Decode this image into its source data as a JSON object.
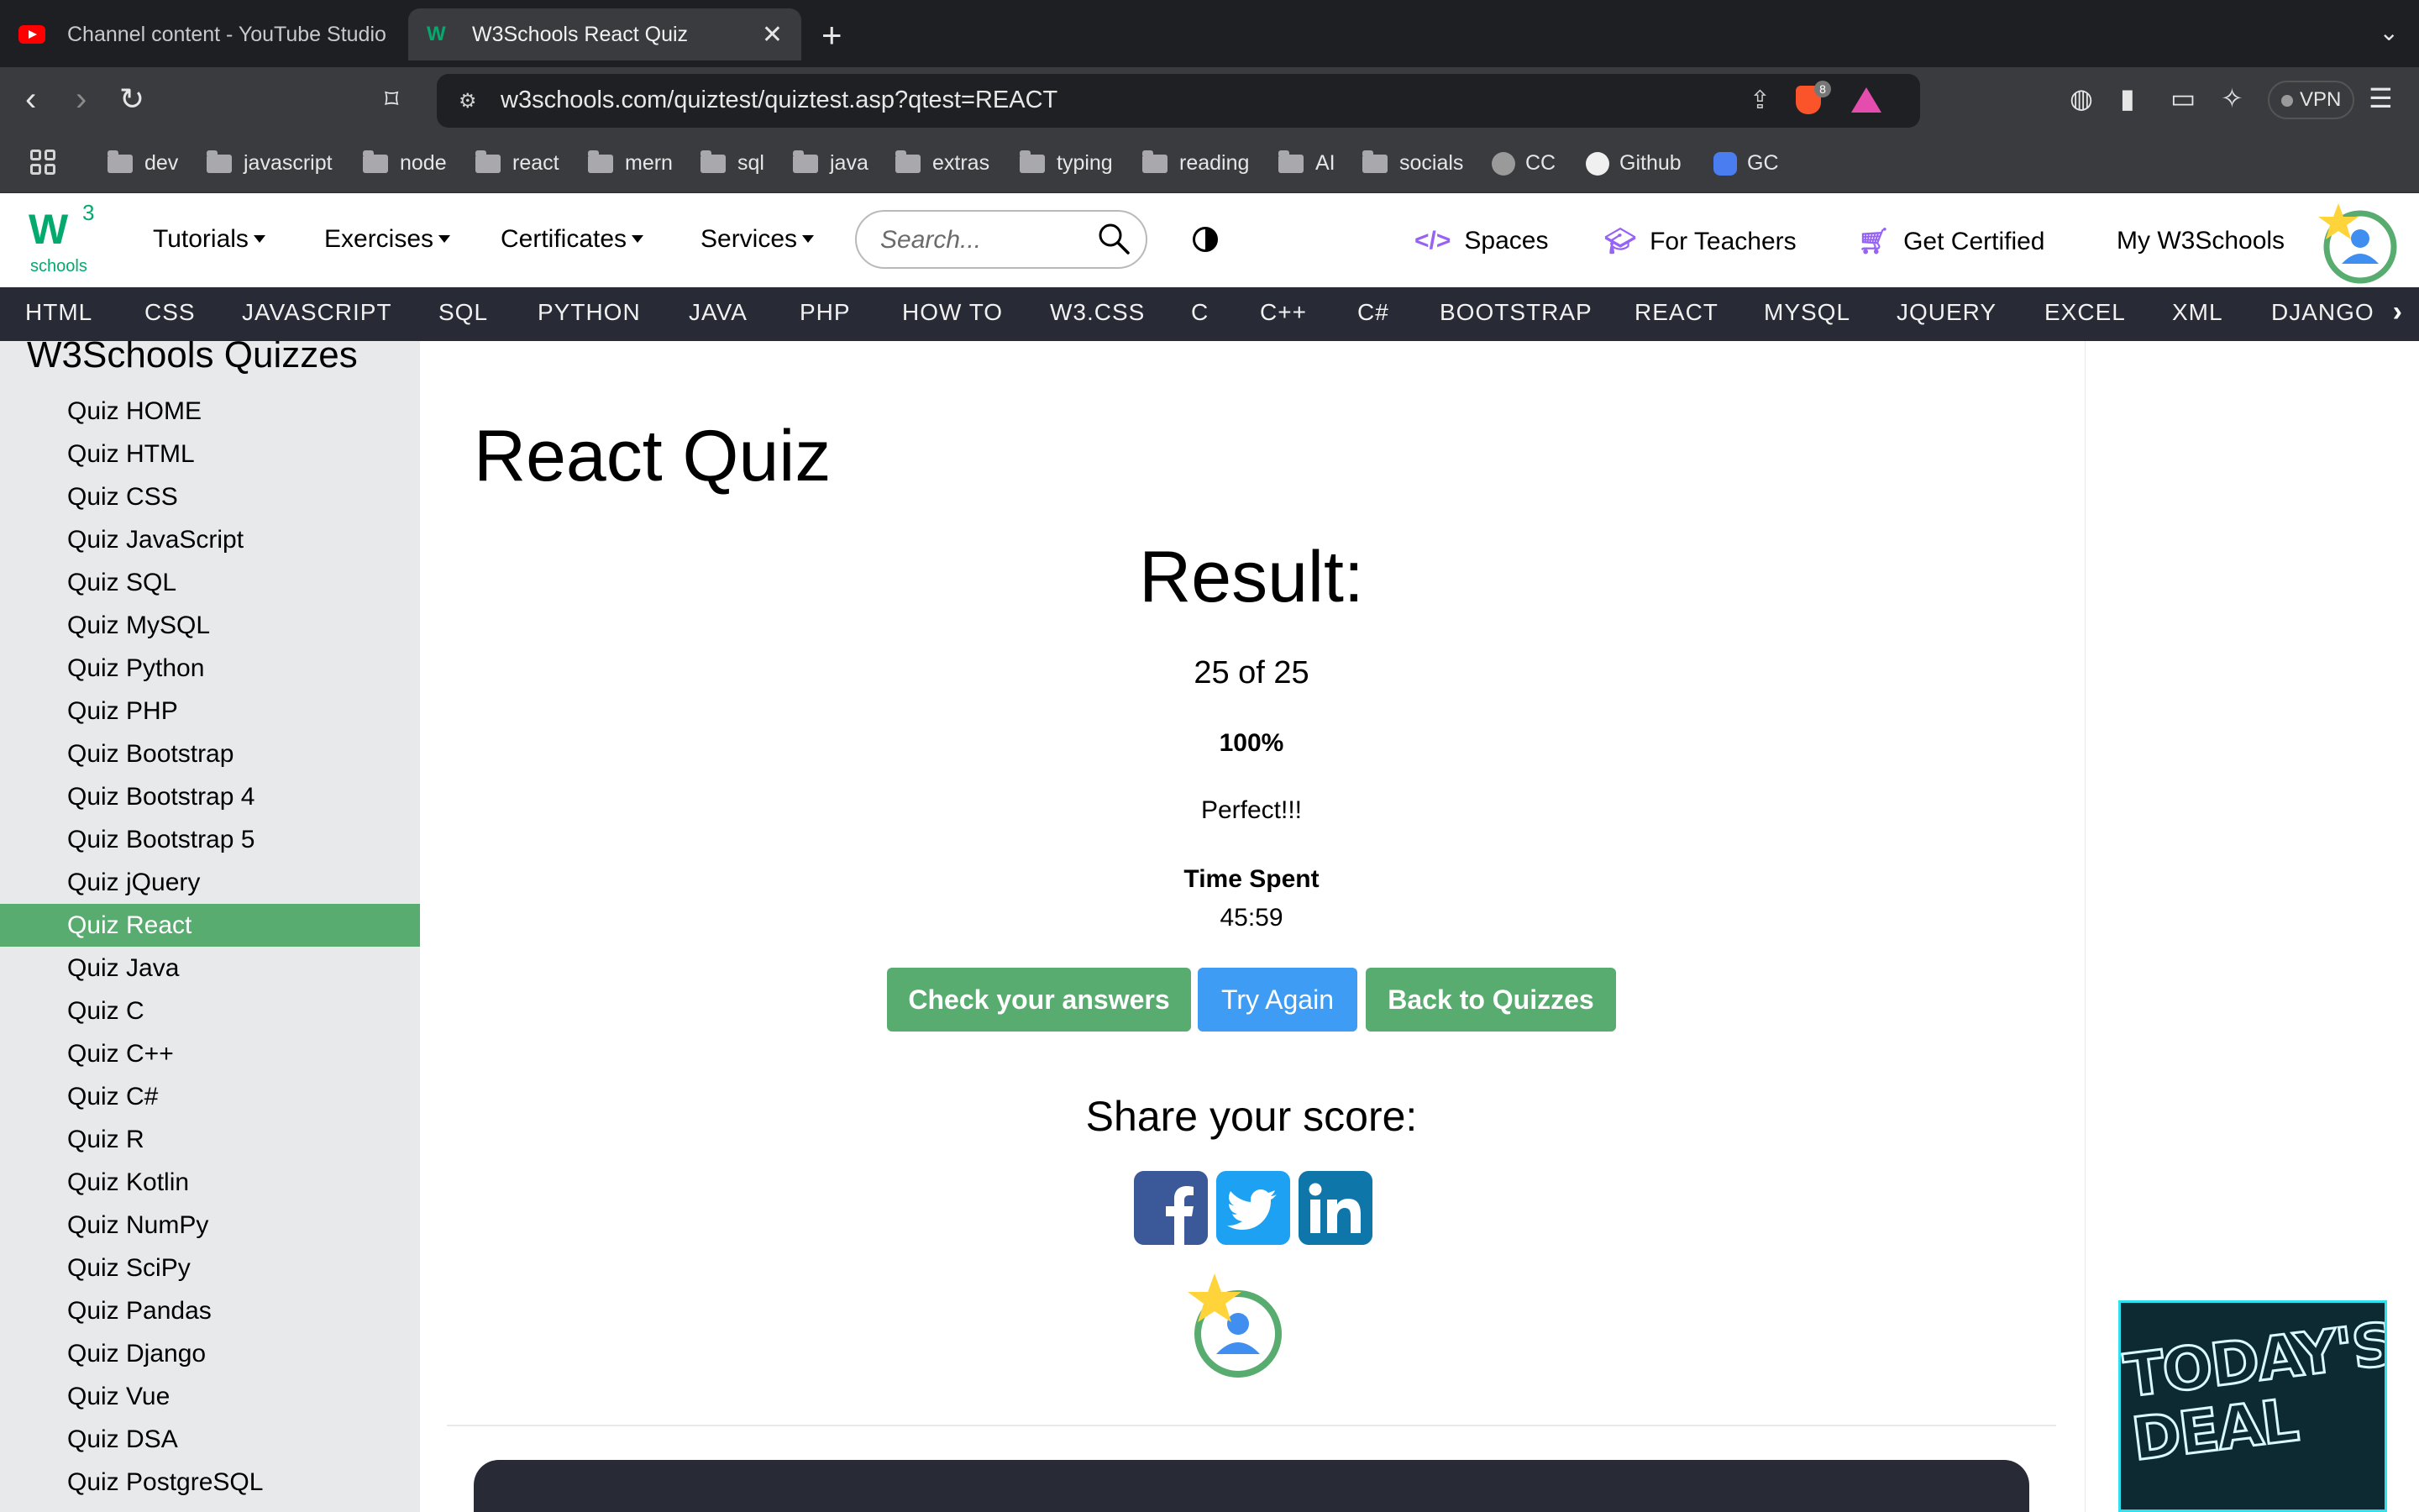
{
  "browser": {
    "tabs": [
      {
        "title": "Channel content - YouTube Studio",
        "active": false,
        "icon": "youtube-icon"
      },
      {
        "title": "W3Schools React Quiz",
        "active": true,
        "icon": "w3schools-icon"
      }
    ],
    "url": "w3schools.com/quiztest/quiztest.asp?qtest=REACT",
    "brave_badge": "8",
    "vpn_label": "VPN",
    "bookmarks": [
      "dev",
      "javascript",
      "node",
      "react",
      "mern",
      "sql",
      "java",
      "extras",
      "typing",
      "reading",
      "AI",
      "socials",
      "CC",
      "Github",
      "GC"
    ]
  },
  "site": {
    "logo_sup": "3",
    "logo_text": "schools",
    "nav": [
      "Tutorials",
      "Exercises",
      "Certificates",
      "Services"
    ],
    "search_placeholder": "Search...",
    "right_links": [
      "Spaces",
      "For Teachers",
      "Get Certified",
      "My W3Schools"
    ],
    "topics": [
      "HTML",
      "CSS",
      "JAVASCRIPT",
      "SQL",
      "PYTHON",
      "JAVA",
      "PHP",
      "HOW TO",
      "W3.CSS",
      "C",
      "C++",
      "C#",
      "BOOTSTRAP",
      "REACT",
      "MYSQL",
      "JQUERY",
      "EXCEL",
      "XML",
      "DJANGO"
    ]
  },
  "sidebar": {
    "title": "W3Schools Quizzes",
    "items": [
      "Quiz HOME",
      "Quiz HTML",
      "Quiz CSS",
      "Quiz JavaScript",
      "Quiz SQL",
      "Quiz MySQL",
      "Quiz Python",
      "Quiz PHP",
      "Quiz Bootstrap",
      "Quiz Bootstrap 4",
      "Quiz Bootstrap 5",
      "Quiz jQuery",
      "Quiz React",
      "Quiz Java",
      "Quiz C",
      "Quiz C++",
      "Quiz C#",
      "Quiz R",
      "Quiz Kotlin",
      "Quiz NumPy",
      "Quiz SciPy",
      "Quiz Pandas",
      "Quiz Django",
      "Quiz Vue",
      "Quiz DSA",
      "Quiz PostgreSQL"
    ],
    "active": "Quiz React"
  },
  "main": {
    "title": "React Quiz",
    "result_heading": "Result:",
    "score": "25 of 25",
    "percent": "100%",
    "verdict": "Perfect!!!",
    "time_label": "Time Spent",
    "time_value": "45:59",
    "buttons": {
      "check": "Check your answers",
      "again": "Try Again",
      "back": "Back to Quizzes"
    },
    "share_heading": "Share your score:"
  },
  "ad": {
    "text": "TODAY'S DEAL"
  },
  "colors": {
    "accent_green": "#59ac6f",
    "button_blue": "#3f9cf5",
    "topics_bg": "#282a35",
    "sidebar_bg": "#e7e9eb"
  }
}
